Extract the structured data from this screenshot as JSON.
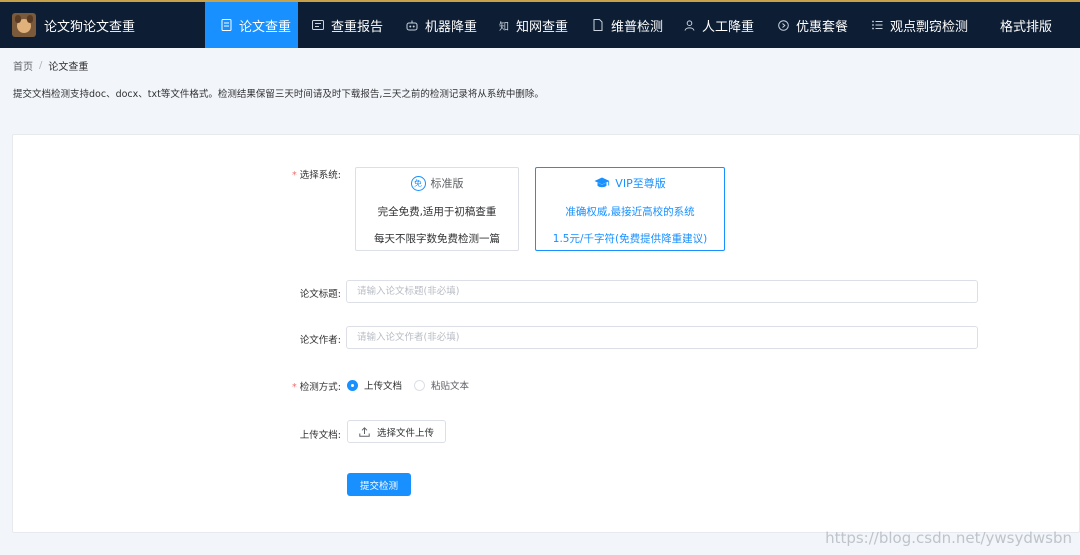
{
  "brand": {
    "title": "论文狗论文查重"
  },
  "nav": {
    "items": [
      {
        "label": "论文查重",
        "icon": "document-icon",
        "active": true
      },
      {
        "label": "查重报告",
        "icon": "report-icon"
      },
      {
        "label": "机器降重",
        "icon": "robot-icon"
      },
      {
        "label": "知网查重",
        "icon": "zhi-icon"
      },
      {
        "label": "维普检测",
        "icon": "file-icon"
      },
      {
        "label": "人工降重",
        "icon": "person-icon"
      },
      {
        "label": "优惠套餐",
        "icon": "coupon-icon"
      },
      {
        "label": "观点剽窃检测",
        "icon": "list-icon"
      },
      {
        "label": "格式排版",
        "icon": ""
      }
    ]
  },
  "breadcrumb": {
    "home": "首页",
    "separator": "/",
    "current": "论文查重"
  },
  "notice": "提交文档检测支持doc、docx、txt等文件格式。检测结果保留三天时间请及时下载报告,三天之前的检测记录将从系统中删除。",
  "form": {
    "system_label": "选择系统:",
    "systems": {
      "standard": {
        "title": "标准版",
        "badge": "免",
        "line1": "完全免费,适用于初稿查重",
        "line2": "每天不限字数免费检测一篇"
      },
      "vip": {
        "title": "VIP至尊版",
        "line1": "准确权威,最接近高校的系统",
        "line2": "1.5元/千字符(免费提供降重建议)"
      }
    },
    "title_label": "论文标题:",
    "title_placeholder": "请输入论文标题(非必填)",
    "author_label": "论文作者:",
    "author_placeholder": "请输入论文作者(非必填)",
    "method_label": "检测方式:",
    "methods": {
      "upload": "上传文档",
      "paste": "粘贴文本"
    },
    "selected_method": "上传文档",
    "upload_label": "上传文档:",
    "upload_button": "选择文件上传",
    "submit_button": "提交检测"
  },
  "watermark": "https://blog.csdn.net/ywsydwsbn",
  "colors": {
    "nav_bg": "#0d1d33",
    "accent": "#1890ff",
    "required": "#f56c6c"
  }
}
